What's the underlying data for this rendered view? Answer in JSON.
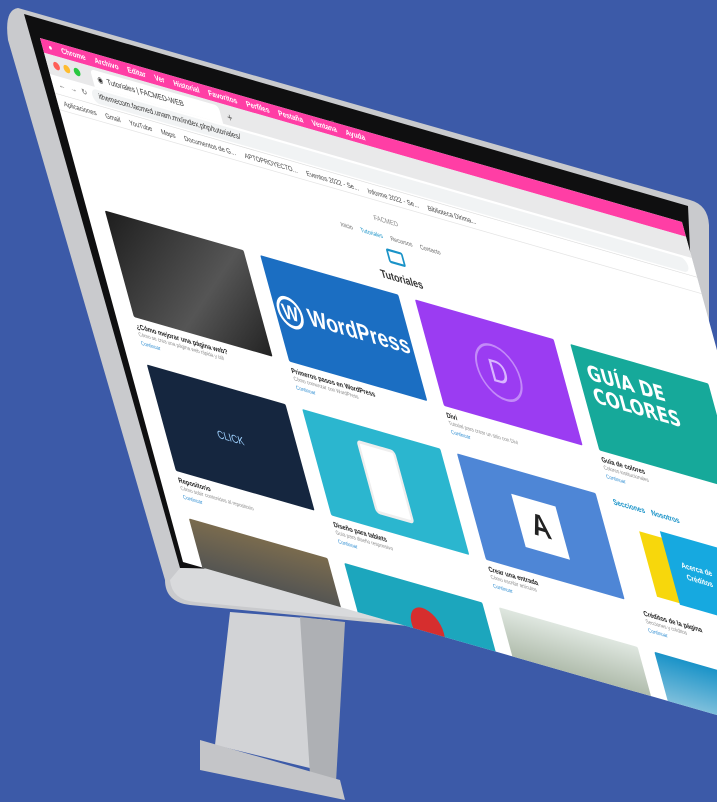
{
  "colors": {
    "background": "#3c5aa8",
    "accent": "#ff3ea5",
    "brand": "#1a93c8"
  },
  "menubar": {
    "items": [
      "Chrome",
      "Archivo",
      "Editar",
      "Ver",
      "Historial",
      "Favoritos",
      "Perfiles",
      "Pestaña",
      "Ventana",
      "Ayuda"
    ]
  },
  "browser": {
    "tab_title": "Tutoriales | FACMED-WEB",
    "tab_add": "+",
    "url": "ithemecom.facmed.unam.mx/index.php/tutoriales/",
    "bookmarks": [
      "Aplicaciones",
      "Gmail",
      "YouTube",
      "Maps",
      "Documentos de G...",
      "APTOPROYECTO...",
      "Eventos 2022 - Se...",
      "Informe 2022 - Se...",
      "Biblioteca Dirima..."
    ]
  },
  "site": {
    "logo_text": "FACMED",
    "nav": [
      "Inicio",
      "Tutoriales",
      "Recursos",
      "Contacto"
    ],
    "hero_title": "Tutoriales",
    "cards": [
      {
        "title": "¿Cómo mejorar una página web?",
        "desc": "Cómo se crea una página web rápida y útil",
        "link": "Continuar"
      },
      {
        "title": "Primeros pasos en WordPress",
        "desc": "Cómo comenzar con WordPress",
        "link": "Continuar",
        "thumb_text": "WordPress"
      },
      {
        "title": "Divi",
        "desc": "Tutorial para crear un sitio con Divi",
        "link": "Continuar",
        "thumb_text": "D"
      },
      {
        "title": "Guía de colores",
        "desc": "Colores institucionales",
        "link": "Continuar",
        "thumb_text": "GUÍA DE COLORES"
      },
      {
        "title": "Repositorio",
        "desc": "Cómo subir contenidos al repositorio",
        "link": "Continuar",
        "thumb_text": "CLICK"
      },
      {
        "title": "Diseño para tablets",
        "desc": "Guía para diseño responsivo",
        "link": "Continuar"
      },
      {
        "title": "Crear una entrada",
        "desc": "Cómo escribir artículos",
        "link": "Continuar",
        "thumb_text": "A"
      },
      {
        "title": "Créditos de la página",
        "desc": "Secciones y créditos",
        "link": "Continuar",
        "sec1": "Secciones",
        "sec2": "Nosotros",
        "thumb_text": "Acerca de Créditos"
      },
      {
        "title": "",
        "desc": "",
        "link": ""
      },
      {
        "title": "",
        "desc": "",
        "link": ""
      },
      {
        "title": "",
        "desc": "",
        "link": ""
      },
      {
        "title": "",
        "desc": "",
        "link": ""
      }
    ]
  }
}
